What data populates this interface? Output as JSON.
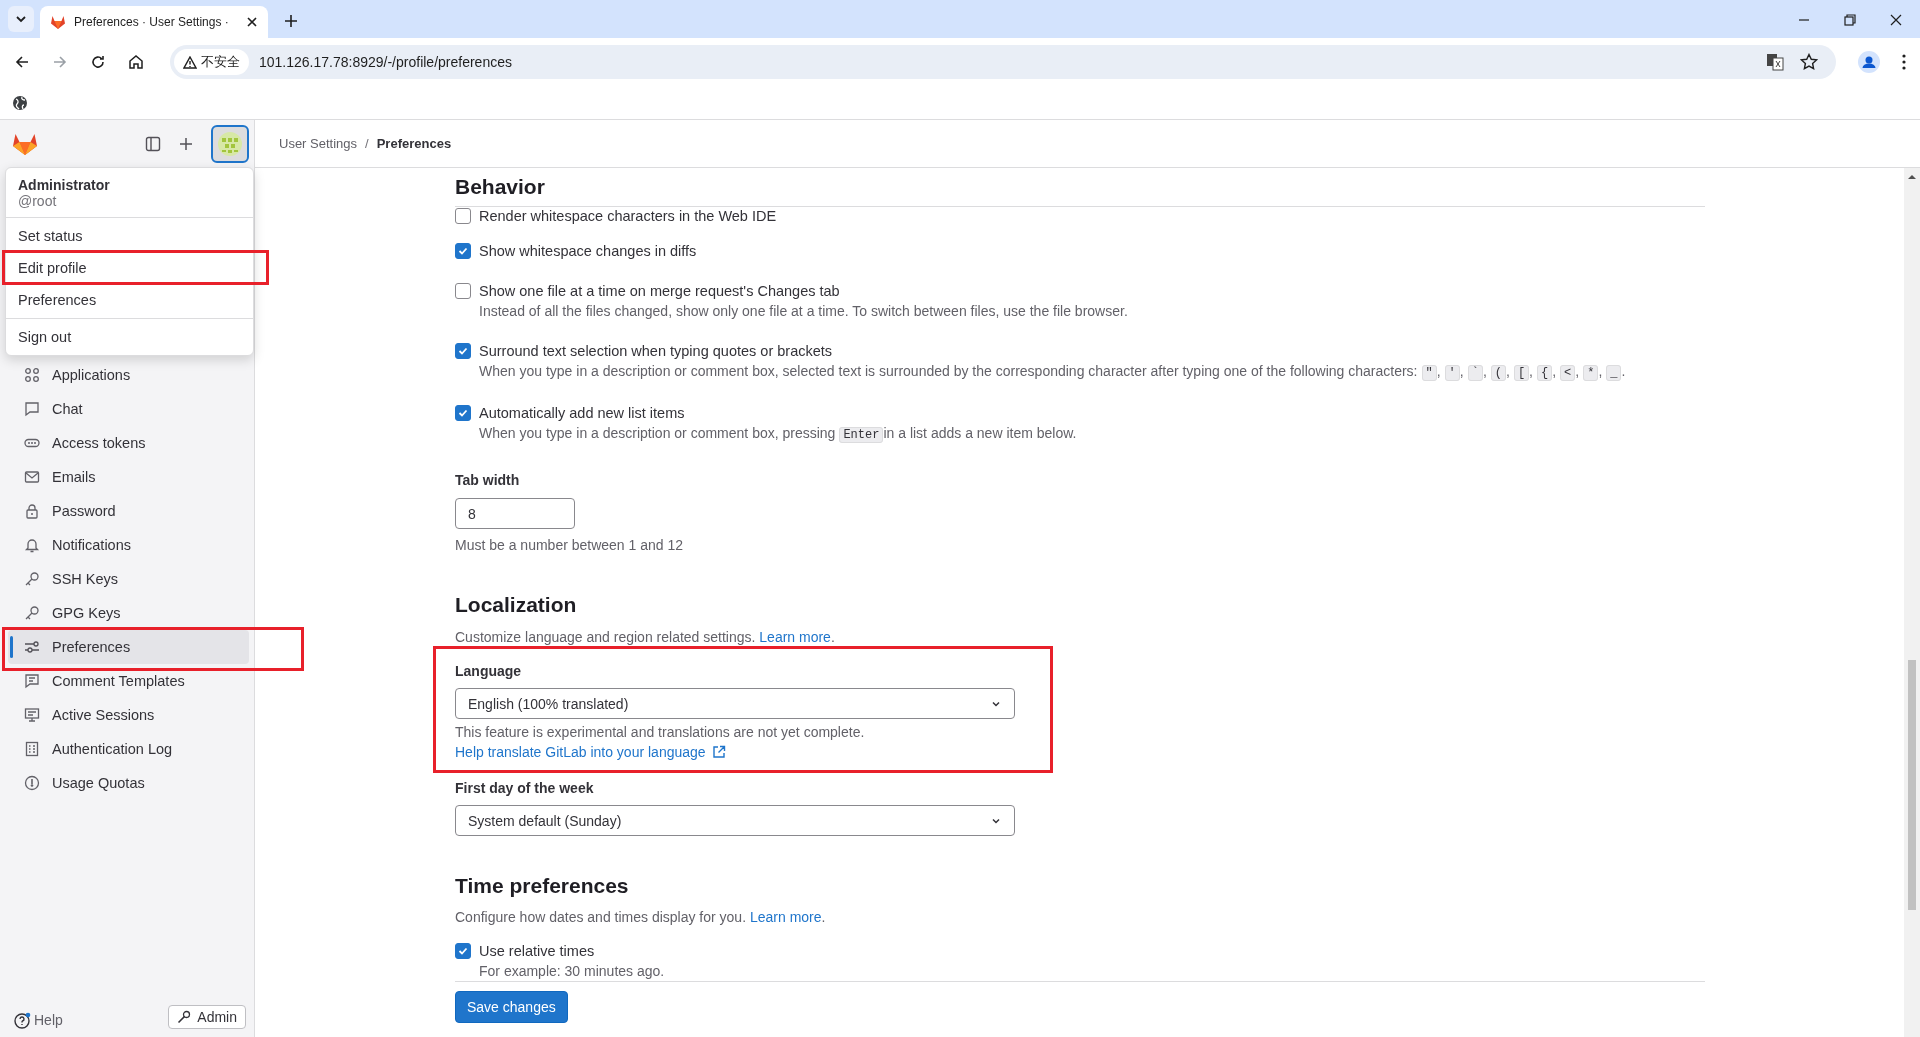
{
  "browser": {
    "tab_title": "Preferences · User Settings ·",
    "security_label": "不安全",
    "url": "101.126.17.78:8929/-/profile/preferences"
  },
  "breadcrumb_separator": "/",
  "breadcrumbs": [
    {
      "label": "User Settings",
      "current": false
    },
    {
      "label": "Preferences",
      "current": true
    }
  ],
  "user_menu": {
    "name": "Administrator",
    "username": "@root",
    "groups": [
      [
        {
          "label": "Set status",
          "highlighted": false
        },
        {
          "label": "Edit profile",
          "highlighted": true
        },
        {
          "label": "Preferences",
          "highlighted": false
        }
      ],
      [
        {
          "label": "Sign out",
          "highlighted": false
        }
      ]
    ]
  },
  "sidebar": {
    "items": [
      {
        "label": "Applications",
        "selected": false,
        "highlighted": false
      },
      {
        "label": "Chat",
        "selected": false,
        "highlighted": false
      },
      {
        "label": "Access tokens",
        "selected": false,
        "highlighted": false
      },
      {
        "label": "Emails",
        "selected": false,
        "highlighted": false
      },
      {
        "label": "Password",
        "selected": false,
        "highlighted": false
      },
      {
        "label": "Notifications",
        "selected": false,
        "highlighted": false
      },
      {
        "label": "SSH Keys",
        "selected": false,
        "highlighted": false
      },
      {
        "label": "GPG Keys",
        "selected": false,
        "highlighted": false
      },
      {
        "label": "Preferences",
        "selected": true,
        "highlighted": true
      },
      {
        "label": "Comment Templates",
        "selected": false,
        "highlighted": false
      },
      {
        "label": "Active Sessions",
        "selected": false,
        "highlighted": false
      },
      {
        "label": "Authentication Log",
        "selected": false,
        "highlighted": false
      },
      {
        "label": "Usage Quotas",
        "selected": false,
        "highlighted": false
      }
    ],
    "help": "Help",
    "admin": "Admin"
  },
  "behavior": {
    "title": "Behavior",
    "hidden_row": {
      "label": "Render whitespace characters in the Web IDE",
      "checked": false
    },
    "settings": [
      {
        "label": "Show whitespace changes in diffs",
        "checked": true
      },
      {
        "label": "Show one file at a time on merge request's Changes tab",
        "checked": false,
        "description": [
          {
            "kind": "text",
            "text": "Instead of all the files changed, show only one file at a time. To switch between files, use the file browser."
          }
        ]
      },
      {
        "label": "Surround text selection when typing quotes or brackets",
        "checked": true,
        "description": [
          {
            "kind": "text",
            "text": "When you type in a description or comment box, selected text is surrounded by the corresponding character after typing one of the following characters:"
          },
          {
            "kind": "code",
            "text": "\""
          },
          {
            "kind": "text",
            "text": ","
          },
          {
            "kind": "code",
            "text": "'"
          },
          {
            "kind": "text",
            "text": ","
          },
          {
            "kind": "code",
            "text": "`"
          },
          {
            "kind": "text",
            "text": ","
          },
          {
            "kind": "code",
            "text": "("
          },
          {
            "kind": "text",
            "text": ","
          },
          {
            "kind": "code",
            "text": "["
          },
          {
            "kind": "text",
            "text": ","
          },
          {
            "kind": "code",
            "text": "{"
          },
          {
            "kind": "text",
            "text": ","
          },
          {
            "kind": "code",
            "text": "<"
          },
          {
            "kind": "text",
            "text": ","
          },
          {
            "kind": "code",
            "text": "*"
          },
          {
            "kind": "text",
            "text": ","
          },
          {
            "kind": "code",
            "text": "_"
          },
          {
            "kind": "text",
            "text": "."
          }
        ]
      },
      {
        "label": "Automatically add new list items",
        "checked": true,
        "description": [
          {
            "kind": "text",
            "text": "When you type in a description or comment box, pressing"
          },
          {
            "kind": "code",
            "text": "Enter"
          },
          {
            "kind": "text",
            "text": "in a list adds a new item below."
          }
        ]
      }
    ],
    "tab_width": {
      "label": "Tab width",
      "value": "8",
      "help": "Must be a number between 1 and 12"
    }
  },
  "localization": {
    "title": "Localization",
    "description": "Customize language and region related settings.",
    "link": "Learn more",
    "after": ".",
    "fields": [
      {
        "label": "Language",
        "value": "English (100% translated)",
        "help": "This feature is experimental and translations are not yet complete.",
        "link": "Help translate GitLab into your language",
        "highlighted": true
      },
      {
        "label": "First day of the week",
        "value": "System default (Sunday)",
        "highlighted": false
      }
    ]
  },
  "time_preferences": {
    "title": "Time preferences",
    "description": "Configure how dates and times display for you.",
    "link": "Learn more",
    "after": ".",
    "settings": [
      {
        "label": "Use relative times",
        "checked": true,
        "description": "For example: 30 minutes ago."
      }
    ]
  },
  "save_button": "Save changes"
}
